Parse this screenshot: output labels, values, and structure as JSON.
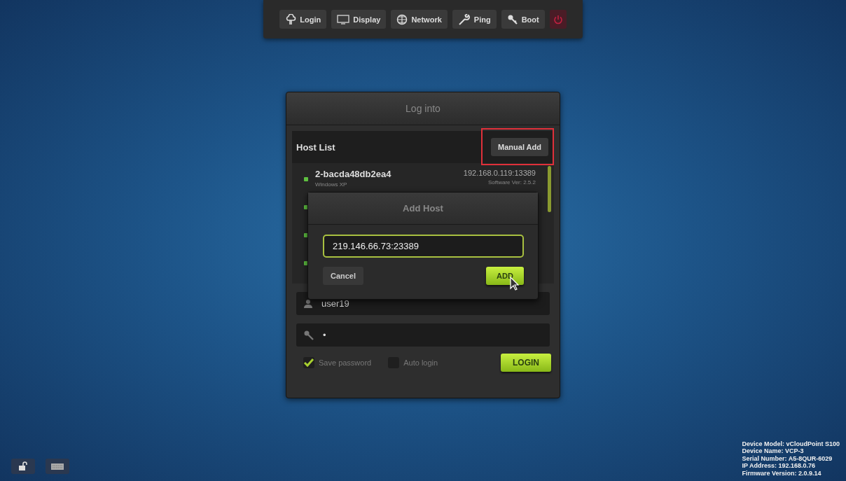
{
  "toolbar": [
    {
      "kind": "login",
      "label": "Login"
    },
    {
      "kind": "display",
      "label": "Display"
    },
    {
      "kind": "network",
      "label": "Network"
    },
    {
      "kind": "ping",
      "label": "Ping"
    },
    {
      "kind": "boot",
      "label": "Boot"
    },
    {
      "kind": "power"
    }
  ],
  "login_panel": {
    "title": "Log into",
    "host_list": {
      "title": "Host List",
      "manual_add": "Manual Add",
      "manual_add_highlighted": true,
      "hosts": [
        {
          "name": "2-bacda48db2ea4",
          "os": "Windows XP",
          "address": "192.168.0.119:13389",
          "version": "Software Ver: 2.5.2",
          "online": true
        },
        {
          "online": true
        },
        {
          "online": true
        },
        {
          "online": true
        }
      ]
    },
    "username": "user19",
    "password": "•",
    "save_password": {
      "label": "Save password",
      "checked": true
    },
    "auto_login": {
      "label": "Auto login",
      "checked": false
    },
    "login_button": "LOGIN"
  },
  "add_host_dialog": {
    "title": "Add Host",
    "value": "219.146.66.73:23389",
    "cancel": "Cancel",
    "add": "ADD"
  },
  "device_info": [
    "Device Model: vCloudPoint S100",
    "Device Name: VCP-3",
    "Serial Number: A5-8QUR-6029",
    "IP Address: 192.168.0.76",
    "Firmware Version: 2.0.9.14"
  ]
}
